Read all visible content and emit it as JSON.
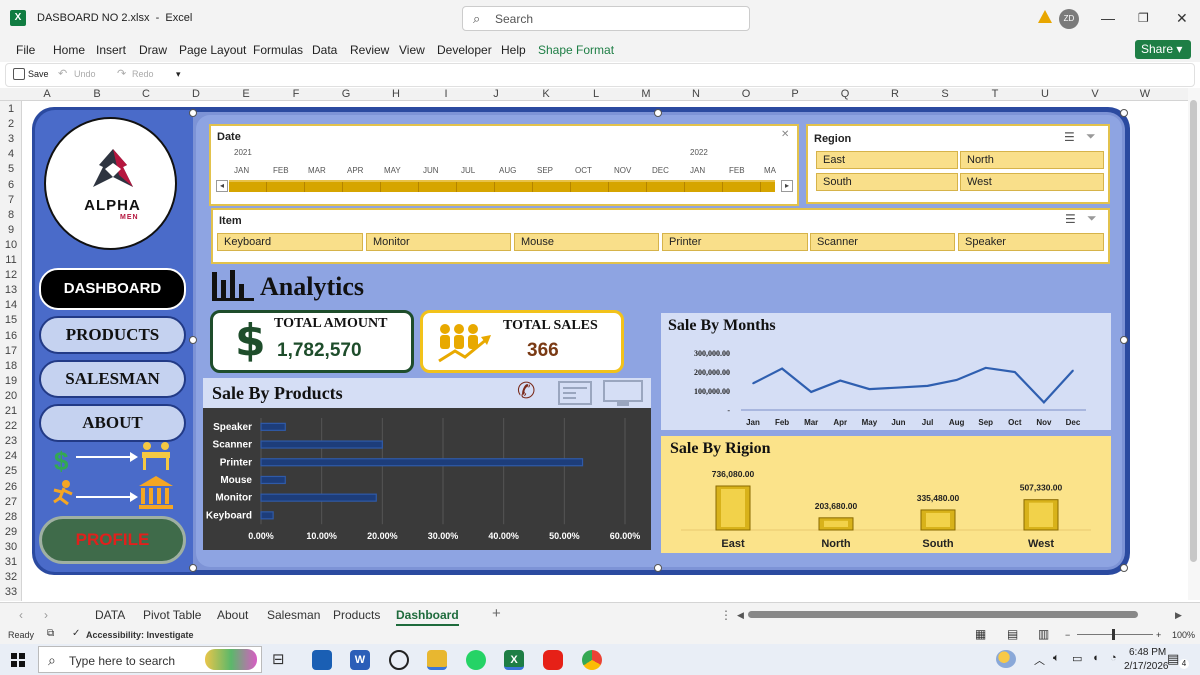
{
  "window": {
    "app_icon": "excel-icon",
    "filename": "DASBOARD NO 2.xlsx",
    "app_name": "Excel",
    "title": "DASBOARD NO 2.xlsx  -  Excel",
    "search_placeholder": "Search",
    "user_initials": "ZD"
  },
  "menu": {
    "items": [
      "File",
      "Home",
      "Insert",
      "Draw",
      "Page Layout",
      "Formulas",
      "Data",
      "Review",
      "View",
      "Developer",
      "Help",
      "Shape Format"
    ],
    "share_label": "Share"
  },
  "quick_access": {
    "save": "Save",
    "undo": "Undo",
    "redo": "Redo"
  },
  "sheet": {
    "columns": [
      "A",
      "B",
      "C",
      "D",
      "E",
      "F",
      "G",
      "H",
      "I",
      "J",
      "K",
      "L",
      "M",
      "N",
      "O",
      "P",
      "Q",
      "R",
      "S",
      "T",
      "U",
      "V",
      "W"
    ],
    "rows": [
      "1",
      "2",
      "3",
      "4",
      "5",
      "6",
      "7",
      "8",
      "9",
      "10",
      "11",
      "12",
      "13",
      "14",
      "15",
      "16",
      "17",
      "18",
      "19",
      "20",
      "21",
      "22",
      "23",
      "24",
      "25",
      "26",
      "27",
      "28",
      "29",
      "30",
      "31",
      "32",
      "33"
    ]
  },
  "dashboard": {
    "logo": {
      "brand": "ALPHA",
      "sub": "MEN"
    },
    "nav": {
      "dashboard": "DASHBOARD",
      "products": "PRODUCTS",
      "salesman": "SALESMAN",
      "about": "ABOUT",
      "profile": "PROFILE"
    },
    "date_slicer": {
      "title": "Date",
      "years": [
        "2021",
        "2022"
      ],
      "months": [
        "JAN",
        "FEB",
        "MAR",
        "APR",
        "MAY",
        "JUN",
        "JUL",
        "AUG",
        "SEP",
        "OCT",
        "NOV",
        "DEC",
        "JAN",
        "FEB",
        "MA"
      ]
    },
    "region_slicer": {
      "title": "Region",
      "items": [
        "East",
        "North",
        "South",
        "West"
      ]
    },
    "item_slicer": {
      "title": "Item",
      "items": [
        "Keyboard",
        "Monitor",
        "Mouse",
        "Printer",
        "Scanner",
        "Speaker"
      ]
    },
    "analytics_title": "Analytics",
    "kpi": {
      "total_amount_label": "TOTAL AMOUNT",
      "total_amount_value": "1,782,570",
      "total_sales_label": "TOTAL SALES",
      "total_sales_value": "366"
    }
  },
  "chart_data": [
    {
      "type": "bar",
      "orientation": "horizontal",
      "title": "Sale By Products",
      "categories": [
        "Speaker",
        "Scanner",
        "Printer",
        "Mouse",
        "Monitor",
        "Keyboard"
      ],
      "values": [
        0.04,
        0.2,
        0.53,
        0.04,
        0.19,
        0.02
      ],
      "xlim": [
        0,
        0.6
      ],
      "ticks": [
        "0.00%",
        "10.00%",
        "20.00%",
        "30.00%",
        "40.00%",
        "50.00%",
        "60.00%"
      ],
      "grid": true,
      "colors": {
        "bar": "#2f5aa8",
        "background": "#3a3a3a"
      }
    },
    {
      "type": "line",
      "title": "Sale By Months",
      "categories": [
        "Jan",
        "Feb",
        "Mar",
        "Apr",
        "May",
        "Jun",
        "Jul",
        "Aug",
        "Sep",
        "Oct",
        "Nov",
        "Dec"
      ],
      "values": [
        140000,
        218000,
        95000,
        155000,
        110000,
        118000,
        127000,
        158000,
        222000,
        200000,
        40000,
        208000
      ],
      "ylim": [
        0,
        300000
      ],
      "yticks": [
        "300,000.00",
        "200,000.00",
        "100,000.00",
        "-"
      ],
      "colors": {
        "line": "#2f5fb0"
      }
    },
    {
      "type": "bar",
      "title": "Sale By Rigion",
      "categories": [
        "East",
        "North",
        "South",
        "West"
      ],
      "values": [
        736080,
        203680,
        335480,
        507330
      ],
      "labels": [
        "736,080.00",
        "203,680.00",
        "335,480.00",
        "507,330.00"
      ],
      "colors": {
        "bar": "#d8b21a",
        "background": "#fbe38a"
      }
    }
  ],
  "tabs": {
    "items": [
      "DATA",
      "Pivot Table",
      "About",
      "Salesman",
      "Products",
      "Dashboard"
    ],
    "active": "Dashboard"
  },
  "status": {
    "ready": "Ready",
    "accessibility": "Accessibility: Investigate",
    "zoom": "100%"
  },
  "taskbar": {
    "search_placeholder": "Type here to search",
    "time": "6:48 PM",
    "date": "2/17/2026",
    "notifications": "4"
  }
}
